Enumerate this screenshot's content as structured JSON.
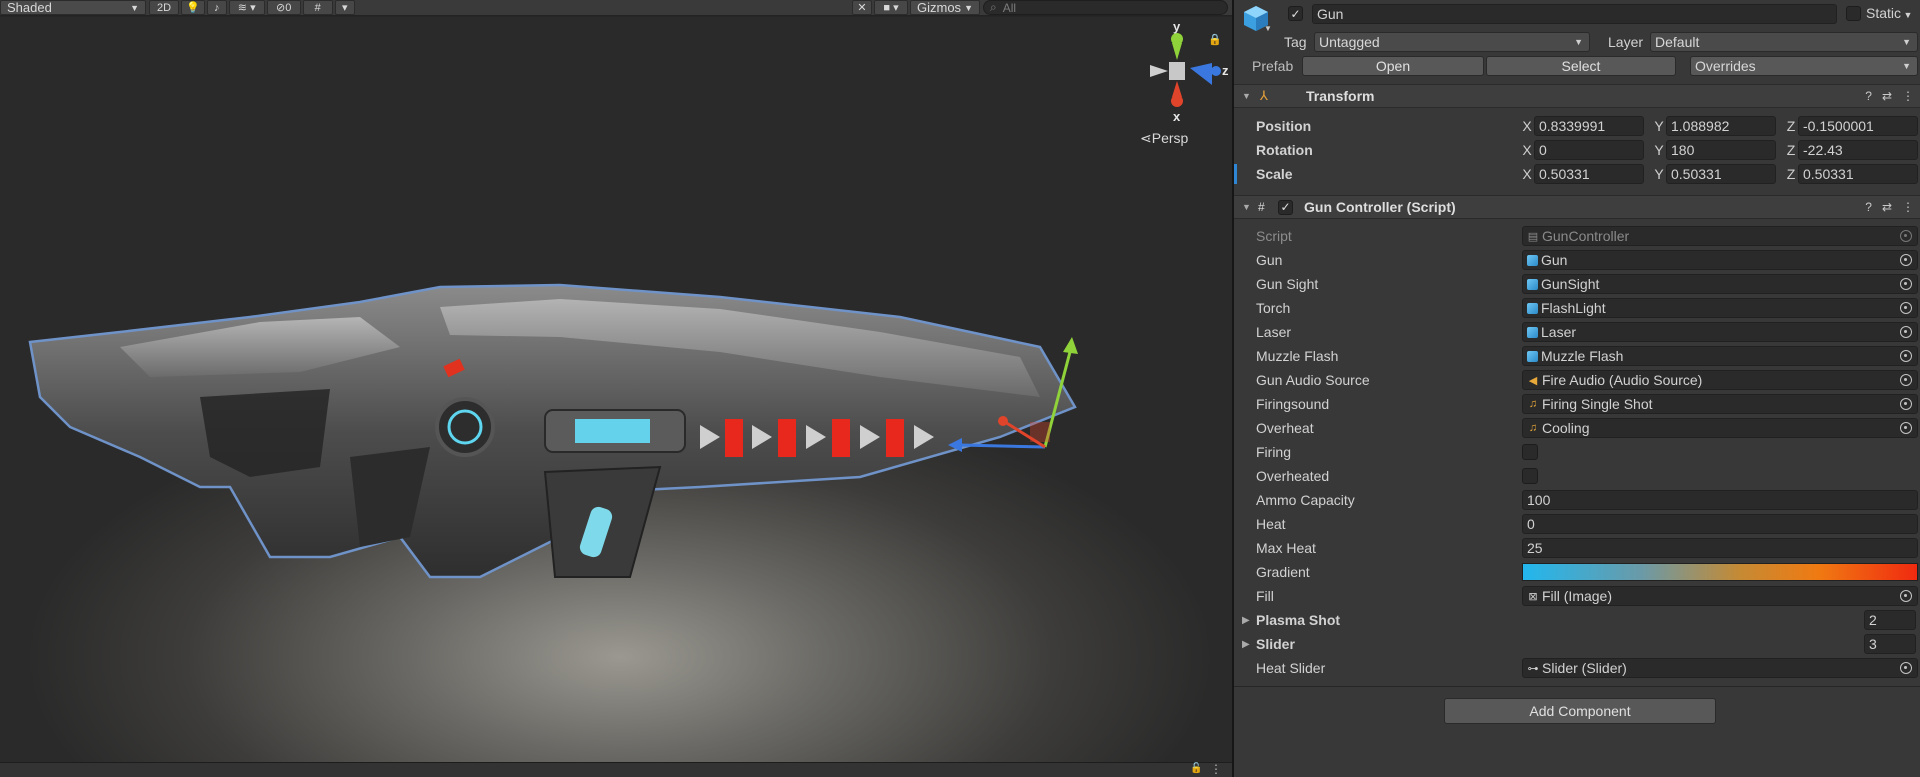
{
  "scene": {
    "shading_mode": "Shaded",
    "mode_2d": "2D",
    "hidden_count": "0",
    "gizmos_label": "Gizmos",
    "search_placeholder": "All",
    "orientation": {
      "y_label": "y",
      "z_label": "z",
      "x_label": "x",
      "projection": "Persp"
    }
  },
  "inspector": {
    "object": {
      "name": "Gun",
      "static_label": "Static",
      "tag_label": "Tag",
      "tag_value": "Untagged",
      "layer_label": "Layer",
      "layer_value": "Default",
      "prefab_label": "Prefab",
      "prefab_open": "Open",
      "prefab_select": "Select",
      "prefab_overrides": "Overrides"
    },
    "transform": {
      "title": "Transform",
      "position": {
        "label": "Position",
        "x": "0.8339991",
        "y": "1.088982",
        "z": "-0.1500001"
      },
      "rotation": {
        "label": "Rotation",
        "x": "0",
        "y": "180",
        "z": "-22.43"
      },
      "scale": {
        "label": "Scale",
        "x": "0.50331",
        "y": "0.50331",
        "z": "0.50331"
      },
      "axis_x": "X",
      "axis_y": "Y",
      "axis_z": "Z"
    },
    "gun_controller": {
      "title": "Gun Controller (Script)",
      "script": {
        "label": "Script",
        "value": "GunController"
      },
      "gun": {
        "label": "Gun",
        "value": "Gun"
      },
      "gun_sight": {
        "label": "Gun Sight",
        "value": "GunSight"
      },
      "torch": {
        "label": "Torch",
        "value": "FlashLight"
      },
      "laser": {
        "label": "Laser",
        "value": "Laser"
      },
      "muzzle_flash": {
        "label": "Muzzle Flash",
        "value": "Muzzle Flash"
      },
      "gun_audio_source": {
        "label": "Gun Audio Source",
        "value": "Fire Audio (Audio Source)"
      },
      "firingsound": {
        "label": "Firingsound",
        "value": "Firing Single Shot"
      },
      "overheat": {
        "label": "Overheat",
        "value": "Cooling"
      },
      "firing": {
        "label": "Firing",
        "checked": false
      },
      "overheated": {
        "label": "Overheated",
        "checked": false
      },
      "ammo_capacity": {
        "label": "Ammo Capacity",
        "value": "100"
      },
      "heat": {
        "label": "Heat",
        "value": "0"
      },
      "max_heat": {
        "label": "Max Heat",
        "value": "25"
      },
      "gradient": {
        "label": "Gradient",
        "colors": [
          "#22b7ee",
          "#f07a12",
          "#f02a10"
        ]
      },
      "fill": {
        "label": "Fill",
        "value": "Fill (Image)"
      },
      "plasma_shot": {
        "label": "Plasma Shot",
        "value": "2"
      },
      "slider": {
        "label": "Slider",
        "value": "3"
      },
      "heat_slider": {
        "label": "Heat Slider",
        "value": "Slider (Slider)"
      }
    },
    "add_component": "Add Component"
  },
  "colors": {
    "selection_outline": "#6f93c8",
    "inspector_bg": "#383838",
    "gizmo_y": "#8fd23a",
    "gizmo_z": "#3a78e0",
    "gizmo_x": "#e0442a"
  }
}
